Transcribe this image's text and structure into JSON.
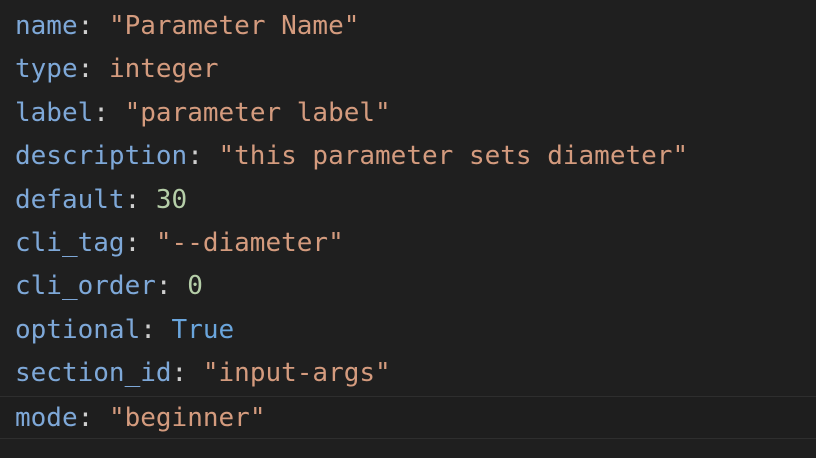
{
  "editor": {
    "lines": [
      {
        "key": "name",
        "value": "\"Parameter Name\"",
        "value_type": "string"
      },
      {
        "key": "type",
        "value": "integer",
        "value_type": "string"
      },
      {
        "key": "label",
        "value": "\"parameter label\"",
        "value_type": "string"
      },
      {
        "key": "description",
        "value": "\"this parameter sets diameter\"",
        "value_type": "string"
      },
      {
        "key": "default",
        "value": "30",
        "value_type": "number"
      },
      {
        "key": "cli_tag",
        "value": "\"--diameter\"",
        "value_type": "string"
      },
      {
        "key": "cli_order",
        "value": "0",
        "value_type": "number"
      },
      {
        "key": "optional",
        "value": "True",
        "value_type": "boolean"
      },
      {
        "key": "section_id",
        "value": "\"input-args\"",
        "value_type": "string"
      },
      {
        "key": "mode",
        "value": "\"beginner\"",
        "value_type": "string"
      }
    ],
    "colon": ":",
    "colors": {
      "background": "#1f1f1f",
      "key": "#7ea8d8",
      "string": "#d49b7e",
      "number": "#b5cea8",
      "boolean": "#6aa5dc"
    }
  }
}
